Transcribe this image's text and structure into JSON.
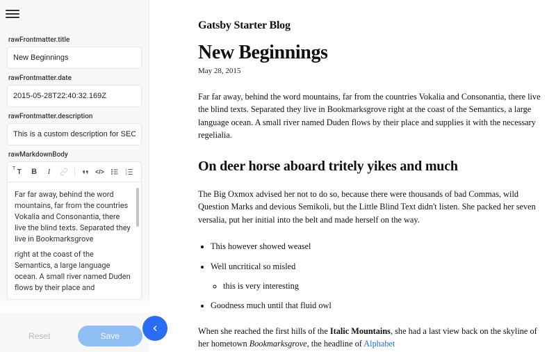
{
  "sidebar": {
    "fields": {
      "title": {
        "label": "rawFrontmatter.title",
        "value": "New Beginnings"
      },
      "date": {
        "label": "rawFrontmatter.date",
        "value": "2015-05-28T22:40:32.169Z"
      },
      "description": {
        "label": "rawFrontmatter.description",
        "value": "This is a custom description for SEO and"
      },
      "body": {
        "label": "rawMarkdownBody",
        "content_p1": "Far far away, behind the word mountains, far from the countries Vokalia and Consonantia, there live the blind texts. Separated they live in Bookmarksgrove",
        "content_p2": "right at the coast of the Semantics, a large language ocean. A small river named Duden flows by their place and"
      }
    },
    "toolbar": {
      "heading": "T",
      "bold": "B",
      "italic": "I",
      "link": "🔗",
      "quote": "❝",
      "code": "</>",
      "ul": "≣",
      "ol": "≡"
    },
    "buttons": {
      "reset": "Reset",
      "save": "Save"
    }
  },
  "preview": {
    "site_title": "Gatsby Starter Blog",
    "post_title": "New Beginnings",
    "post_date": "May 28, 2015",
    "para1": "Far far away, behind the word mountains, far from the countries Vokalia and Consonantia, there live the blind texts. Separated they live in Bookmarksgrove right at the coast of the Semantics, a large language ocean. A small river named Duden flows by their place and supplies it with the necessary regelialia.",
    "heading2": "On deer horse aboard tritely yikes and much",
    "para2": "The Big Oxmox advised her not to do so, because there were thousands of bad Commas, wild Question Marks and devious Semikoli, but the Little Blind Text didn't listen. She packed her seven versalia, put her initial into the belt and made herself on the way.",
    "li1": "This however showed weasel",
    "li2": "Well uncritical so misled",
    "li2a": "this is very interesting",
    "li3": "Goodness much until that fluid owl",
    "para3_pre": "When she reached the first hills of the ",
    "para3_bold": "Italic Mountains",
    "para3_mid": ", she had a last view back on the skyline of her hometown ",
    "para3_ital": "Bookmarksgrove",
    "para3_post": ", the headline of ",
    "para3_link": "Alphabet"
  }
}
